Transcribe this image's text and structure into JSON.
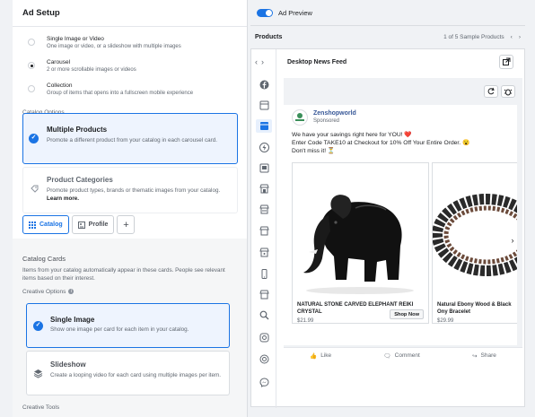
{
  "left": {
    "title": "Ad Setup",
    "formats": [
      {
        "title": "Single Image or Video",
        "desc": "One image or video, or a slideshow with multiple images"
      },
      {
        "title": "Carousel",
        "desc": "2 or more scrollable images or videos"
      },
      {
        "title": "Collection",
        "desc": "Group of items that opens into a fullscreen mobile experience"
      }
    ],
    "catalog_options_label": "Catalog Options",
    "multiple_products": {
      "title": "Multiple Products",
      "desc": "Promote a different product from your catalog in each carousel card."
    },
    "product_categories": {
      "title": "Product Categories",
      "desc": "Promote product types, brands or thematic images from your catalog.",
      "link": "Learn more."
    },
    "tabs": {
      "catalog": "Catalog",
      "profile": "Profile",
      "plus": "+"
    },
    "catalog_cards_title": "Catalog Cards",
    "catalog_cards_desc": "Items from your catalog automatically appear in these cards. People see relevant items based on their interest.",
    "creative_options": "Creative Options",
    "single_image": {
      "title": "Single Image",
      "desc": "Show one image per card for each item in your catalog."
    },
    "slideshow": {
      "title": "Slideshow",
      "desc": "Create a looping video for each card using multiple images per item."
    },
    "creative_tools": "Creative Tools"
  },
  "right": {
    "ad_preview_label": "Ad Preview",
    "products_label": "Products",
    "products_counter": "1 of 5 Sample Products",
    "feed_title": "Desktop News Feed",
    "post": {
      "page_name": "Zenshopworld",
      "sponsored": "Sponsored",
      "line1": "We have your savings right here for YOU! ❤️",
      "line2": "Enter Code TAKE10 at Checkout for 10% Off Your Entire Order. 😮",
      "line3": "Don't miss it! ⏳"
    },
    "items": [
      {
        "name": "NATURAL STONE CARVED ELEPHANT REIKI CRYSTAL",
        "price": "$21.99",
        "cta": "Shop Now"
      },
      {
        "name": "Natural Ebony Wood & Black Ony Bracelet",
        "price": "$29.99"
      }
    ],
    "actions": {
      "like": "Like",
      "comment": "Comment",
      "share": "Share"
    }
  },
  "colors": {
    "accent": "#1b74e4",
    "selected_bg": "#eef4fe"
  }
}
